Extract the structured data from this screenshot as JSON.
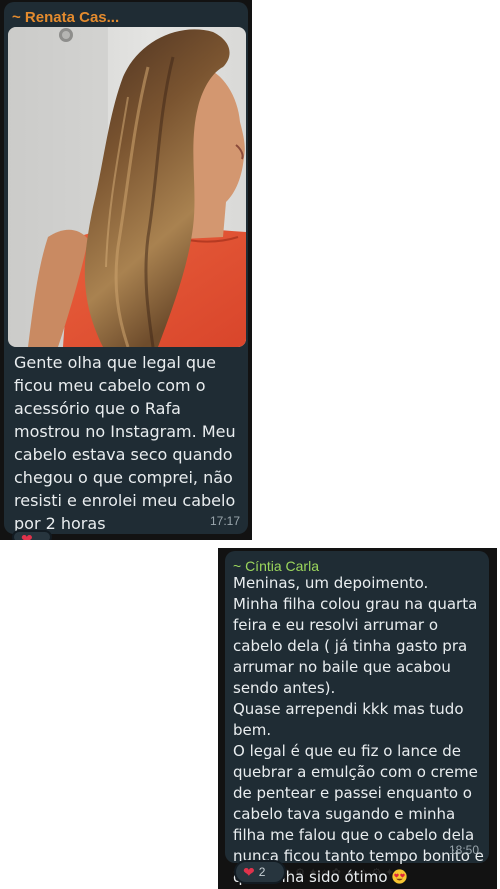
{
  "messages": [
    {
      "sender": "~ Renata Cas...",
      "text": "Gente olha que legal que ficou meu cabelo com o acessório que o Rafa mostrou no Instagram. Meu cabelo estava seco quando chegou o que comprei, não resisti e enrolei meu cabelo por 2 horas",
      "time": "17:17",
      "image": "photo-woman-long-hair"
    },
    {
      "sender": "~ Cíntia Carla",
      "text": "Meninas, um depoimento.\nMinha filha colou grau na quarta feira e eu resolvi arrumar o cabelo dela ( já tinha gasto pra arrumar no baile que acabou sendo antes).\nQuase arrependi kkk mas tudo bem.\nO legal é que eu fiz o lance de quebrar a emulção com o creme de pentear e passei enquanto o cabelo tava sugando e minha filha me falou que o cabelo dela nunca ficou tanto tempo bonito e que tinha sido ótimo",
      "text_emoji": "heart-eyes-emoji",
      "time": "18:50",
      "reaction": {
        "emoji": "heart-icon",
        "count": "2"
      }
    }
  ],
  "colors": {
    "bubble": "#1f2c34",
    "background": "#121212",
    "sender1": "#e48b2e",
    "sender2": "#9bd65c",
    "text": "#e9edef",
    "timestamp": "#9aa6ad"
  }
}
